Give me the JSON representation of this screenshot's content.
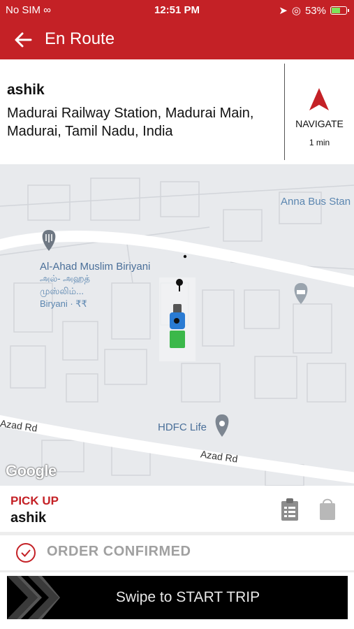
{
  "status_bar": {
    "carrier": "No SIM",
    "time": "12:51 PM",
    "battery": "53%",
    "battery_level": 0.53
  },
  "header": {
    "title": "En Route",
    "back_icon": "arrow-left-icon"
  },
  "destination": {
    "name": "ashik",
    "address": "Madurai Railway Station, Madurai Main, Madurai, Tamil Nadu, India",
    "navigate_label": "NAVIGATE",
    "eta": "1 min"
  },
  "map": {
    "labels": {
      "bus_stand": "Anna Bus Stan",
      "restaurant": "Al-Ahad Muslim Biriyani",
      "restaurant_tamil_1": "அல்- அஹத்",
      "restaurant_tamil_2": "முஸ்லிம்...",
      "restaurant_sub": "Biryani · ₹₹",
      "hdfc": "HDFC Life",
      "road_1": "Azad Rd",
      "road_2": "Azad Rd",
      "google": "Google"
    }
  },
  "pickup": {
    "heading": "PICK UP",
    "name": "ashik"
  },
  "order_status": {
    "text": "ORDER CONFIRMED"
  },
  "swipe": {
    "label": "Swipe to START TRIP"
  },
  "colors": {
    "brand_red": "#c42126",
    "battery_green": "#7ee35a",
    "map_bg": "#e8eaed",
    "poi_blue": "#5b86b0"
  }
}
